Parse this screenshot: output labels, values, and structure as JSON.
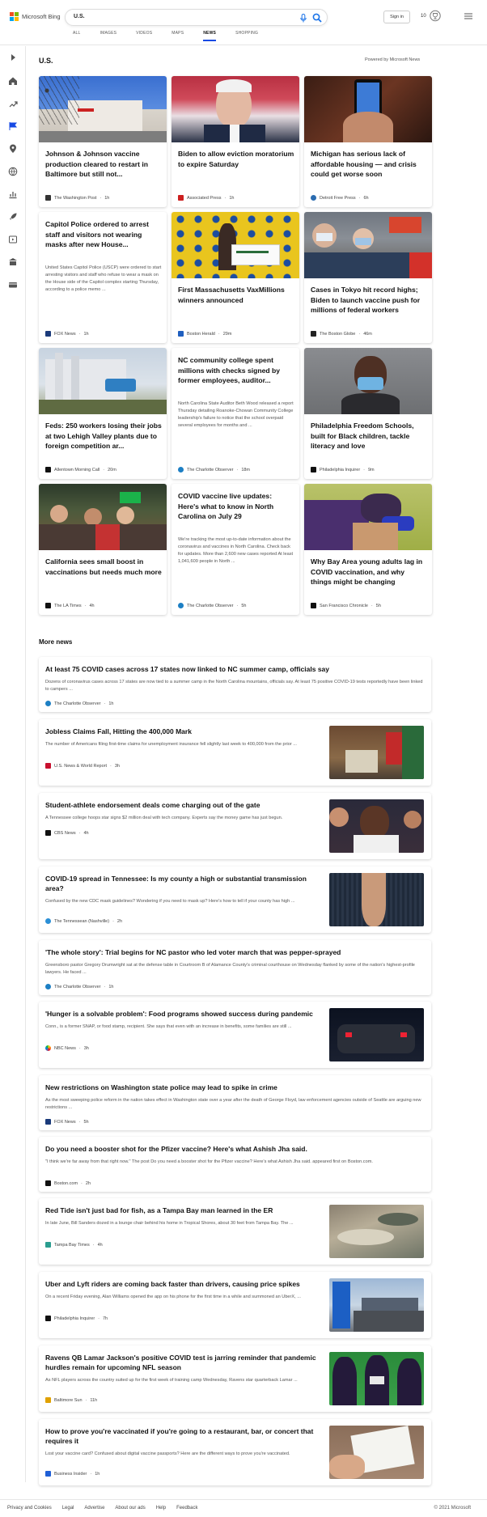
{
  "header": {
    "brand": "Microsoft Bing",
    "search_value": "U.S.",
    "signin_label": "Sign in",
    "rewards_count": "10"
  },
  "tabs": [
    "ALL",
    "IMAGES",
    "VIDEOS",
    "MAPS",
    "NEWS",
    "SHOPPING"
  ],
  "active_tab": "NEWS",
  "section_title": "U.S.",
  "powered_by": "Powered by Microsoft News",
  "cards": [
    {
      "title": "Johnson & Johnson vaccine production cleared to restart in Baltimore but still not...",
      "snippet": "",
      "source": "The Washington Post",
      "time": "1h",
      "src_color": "#333333"
    },
    {
      "title": "Biden to allow eviction moratorium to expire Saturday",
      "snippet": "",
      "source": "Associated Press",
      "time": "1h",
      "src_color": "#cc1f1f"
    },
    {
      "title": "Michigan has serious lack of affordable housing — and crisis could get worse soon",
      "snippet": "",
      "source": "Detroit Free Press",
      "time": "6h",
      "src_color": "#2b6cb0"
    },
    {
      "title": "Capitol Police ordered to arrest staff and visitors not wearing masks after new House...",
      "snippet": "United States Capitol Police (USCP) were ordered to start arresting visitors and staff who refuse to wear a mask on the House side of the Capitol complex starting Thursday, according to a police memo ...",
      "source": "FOX News",
      "time": "1h",
      "src_color": "#1a3a7a"
    },
    {
      "title": "First Massachusetts VaxMillions winners announced",
      "snippet": "",
      "source": "Boston Herald",
      "time": "29m",
      "src_color": "#1f5fbf"
    },
    {
      "title": "Cases in Tokyo hit record highs; Biden to launch vaccine push for millions of federal workers",
      "snippet": "",
      "source": "The Boston Globe",
      "time": "46m",
      "src_color": "#222222"
    },
    {
      "title": "Feds: 250 workers losing their jobs at two Lehigh Valley plants due to foreign competition ar...",
      "snippet": "",
      "source": "Allentown Morning Call",
      "time": "20m",
      "src_color": "#111111"
    },
    {
      "title": "NC community college spent millions with checks signed by former employees, auditor...",
      "snippet": "North Carolina State Auditor Beth Wood released a report Thursday detailing Roanoke-Chowan Community College leadership's failure to notice that the school overpaid several employees for months and ...",
      "source": "The Charlotte Observer",
      "time": "18m",
      "src_color": "#1d7fc4"
    },
    {
      "title": "Philadelphia Freedom Schools, built for Black children, tackle literacy and love",
      "snippet": "",
      "source": "Philadelphia Inquirer",
      "time": "9m",
      "src_color": "#111111"
    },
    {
      "title": "California sees small boost in vaccinations but needs much more",
      "snippet": "",
      "source": "The LA Times",
      "time": "4h",
      "src_color": "#111111"
    },
    {
      "title": "COVID vaccine live updates: Here's what to know in North Carolina on July 29",
      "snippet": "We're tracking the most up-to-date information about the coronavirus and vaccines in North Carolina. Check back for updates. More than 2,600 new cases reported At least 1,041,609 people in North ...",
      "source": "The Charlotte Observer",
      "time": "5h",
      "src_color": "#1d7fc4"
    },
    {
      "title": "Why Bay Area young adults lag in COVID vaccination, and why things might be changing",
      "snippet": "",
      "source": "San Francisco Chronicle",
      "time": "5h",
      "src_color": "#111111"
    }
  ],
  "more_news_title": "More news",
  "more_news": [
    {
      "title": "At least 75 COVID cases across 17 states now linked to NC summer camp, officials say",
      "snippet": "Dozens of coronavirus cases across 17 states are now tied to a summer camp in the North Carolina mountains, officials say. At least 75 positive COVID-19 tests reportedly have been linked to campers ...",
      "source": "The Charlotte Observer",
      "time": "1h",
      "src_color": "#1d7fc4"
    },
    {
      "title": "Jobless Claims Fall, Hitting the 400,000 Mark",
      "snippet": "The number of Americans filing first-time claims for unemployment insurance fell slightly last week to 400,000 from the prior ...",
      "source": "U.S. News & World Report",
      "time": "3h",
      "src_color": "#c8102e"
    },
    {
      "title": "Student-athlete endorsement deals come charging out of the gate",
      "snippet": "A Tennessee college hoops star signs $2 million deal with tech company. Experts say the money game has just begun.",
      "source": "CBS News",
      "time": "4h",
      "src_color": "#111111"
    },
    {
      "title": "COVID-19 spread in Tennessee: Is my county a high or substantial transmission area?",
      "snippet": "Confused by the new CDC mask guidelines? Wondering if you need to mask up? Here's how to tell if your county has high ...",
      "source": "The Tennessean (Nashville)",
      "time": "2h",
      "src_color": "#2b8fd6"
    },
    {
      "title": "'The whole story': Trial begins for NC pastor who led voter march that was pepper-sprayed",
      "snippet": "Greensboro pastor Gregory Drumwright sat at the defense table in Courtroom B of Alamance County's criminal courthouse on Wednesday flanked by some of the nation's highest-profile lawyers. He faced ...",
      "source": "The Charlotte Observer",
      "time": "1h",
      "src_color": "#1d7fc4"
    },
    {
      "title": "'Hunger is a solvable problem': Food programs showed success during pandemic",
      "snippet": "Conn., is a former SNAP, or food stamp, recipient. She says that even with an increase in benefits, some families are still ...",
      "source": "NBC News",
      "time": "3h",
      "src_color": "#333333"
    },
    {
      "title": "New restrictions on Washington state police may lead to spike in crime",
      "snippet": "As the most sweeping police reform in the nation takes effect in Washington state over a year after the death of George Floyd, law enforcement agencies outside of Seattle are arguing new restrictions ...",
      "source": "FOX News",
      "time": "5h",
      "src_color": "#1a3a7a"
    },
    {
      "title": "Do you need a booster shot for the Pfizer vaccine? Here's what Ashish Jha said.",
      "snippet": "\"I think we're far away from that right now.\" The post Do you need a booster shot for the Pfizer vaccine? Here's what Ashish Jha said. appeared first on Boston.com.",
      "source": "Boston.com",
      "time": "2h",
      "src_color": "#111111"
    },
    {
      "title": "Red Tide isn't just bad for fish, as a Tampa Bay man learned in the ER",
      "snippet": "In late June, Bill Sanders dozed in a lounge chair behind his home in Tropical Shores, about 30 feet from Tampa Bay. The ...",
      "source": "Tampa Bay Times",
      "time": "4h",
      "src_color": "#2a9d8f"
    },
    {
      "title": "Uber and Lyft riders are coming back faster than drivers, causing price spikes",
      "snippet": "On a recent Friday evening, Alan Williams opened the app on his phone for the first time in a while and summoned an UberX, ...",
      "source": "Philadelphia Inquirer",
      "time": "7h",
      "src_color": "#111111"
    },
    {
      "title": "Ravens QB Lamar Jackson's positive COVID test is jarring reminder that pandemic hurdles remain for upcoming NFL season",
      "snippet": "As NFL players across the country suited up for the first week of training camp Wednesday, Ravens star quarterback Lamar ...",
      "source": "Baltimore Sun",
      "time": "11h",
      "src_color": "#e0a100"
    },
    {
      "title": "How to prove you're vaccinated if you're going to a restaurant, bar, or concert that requires it",
      "snippet": "Lost your vaccine card? Confused about digital vaccine passports? Here are the different ways to prove you're vaccinated.",
      "source": "Business Insider",
      "time": "1h",
      "src_color": "#1f5fd6"
    }
  ],
  "footer": {
    "links": [
      "Privacy and Cookies",
      "Legal",
      "Advertise",
      "About our ads",
      "Help",
      "Feedback"
    ],
    "copyright": "© 2021 Microsoft"
  }
}
